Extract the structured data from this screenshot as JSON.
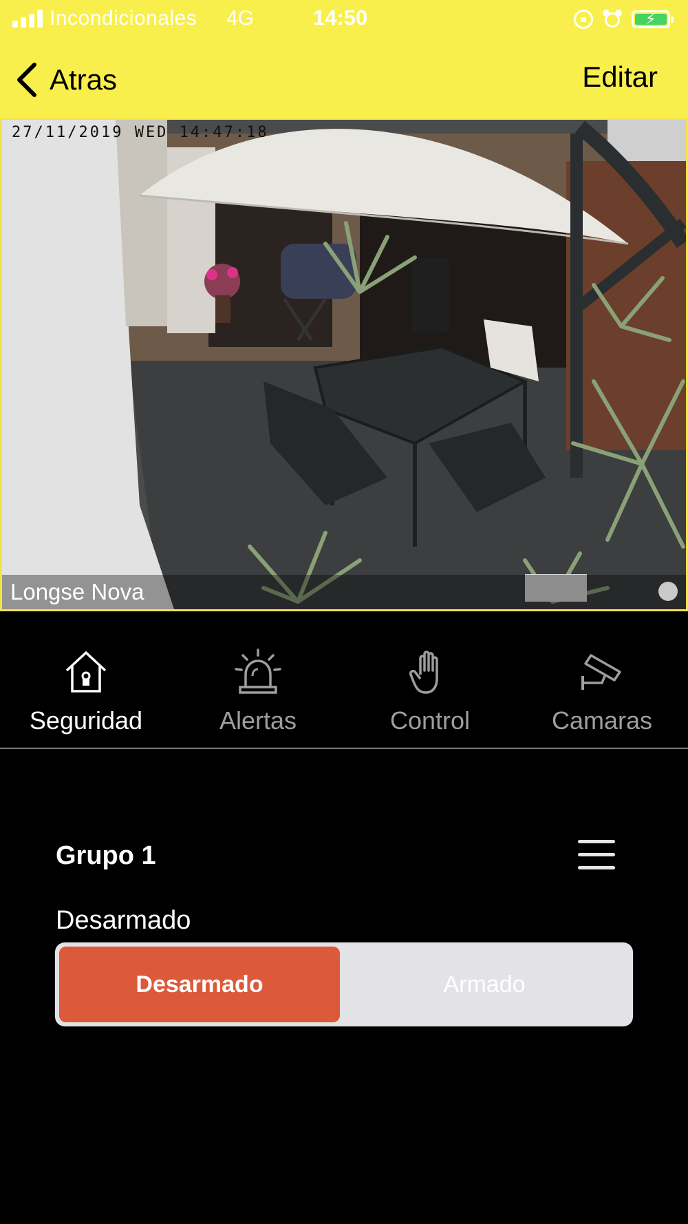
{
  "status_bar": {
    "carrier": "Incondicionales",
    "network": "4G",
    "time": "14:50",
    "battery_color": "#46d35e"
  },
  "nav": {
    "back_label": "Atras",
    "edit_label": "Editar",
    "header_color": "#f9ef4c"
  },
  "camera": {
    "timestamp_overlay": "27/11/2019 WED 14:47:18",
    "name": "Longse Nova"
  },
  "tabs": [
    {
      "label": "Seguridad",
      "icon": "house-lock-icon",
      "active": true
    },
    {
      "label": "Alertas",
      "icon": "siren-icon",
      "active": false
    },
    {
      "label": "Control",
      "icon": "hand-icon",
      "active": false
    },
    {
      "label": "Camaras",
      "icon": "security-camera-icon",
      "active": false
    }
  ],
  "group": {
    "title": "Grupo 1",
    "status": "Desarmado",
    "options": [
      "Desarmado",
      "Armado"
    ],
    "selected": "Desarmado",
    "accent_color": "#dc5a3a"
  }
}
